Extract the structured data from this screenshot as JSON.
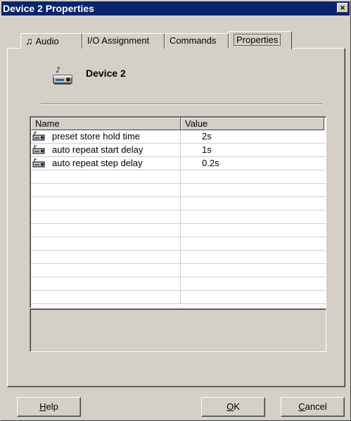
{
  "window": {
    "title": "Device 2 Properties",
    "close_glyph": "×"
  },
  "tabs": [
    {
      "label": "Audio",
      "icon": "music-note-icon"
    },
    {
      "label": "I/O Assignment"
    },
    {
      "label": "Commands"
    },
    {
      "label": "Properties",
      "active": true
    }
  ],
  "device": {
    "name": "Device 2",
    "icon": "device-icon"
  },
  "list": {
    "columns": [
      "Name",
      "Value"
    ],
    "rows": [
      {
        "name": "preset store hold time",
        "value": "2s",
        "icon": "property-icon"
      },
      {
        "name": "auto repeat start delay",
        "value": "1s",
        "icon": "property-icon"
      },
      {
        "name": "auto repeat step delay",
        "value": "0.2s",
        "icon": "property-icon"
      }
    ]
  },
  "buttons": {
    "help": {
      "mnemonic": "H",
      "rest": "elp"
    },
    "ok": {
      "mnemonic": "O",
      "rest": "K"
    },
    "cancel": {
      "mnemonic": "C",
      "rest": "ancel"
    }
  },
  "colors": {
    "face": "#d4d0c8",
    "titlebar": "#0a246a"
  }
}
